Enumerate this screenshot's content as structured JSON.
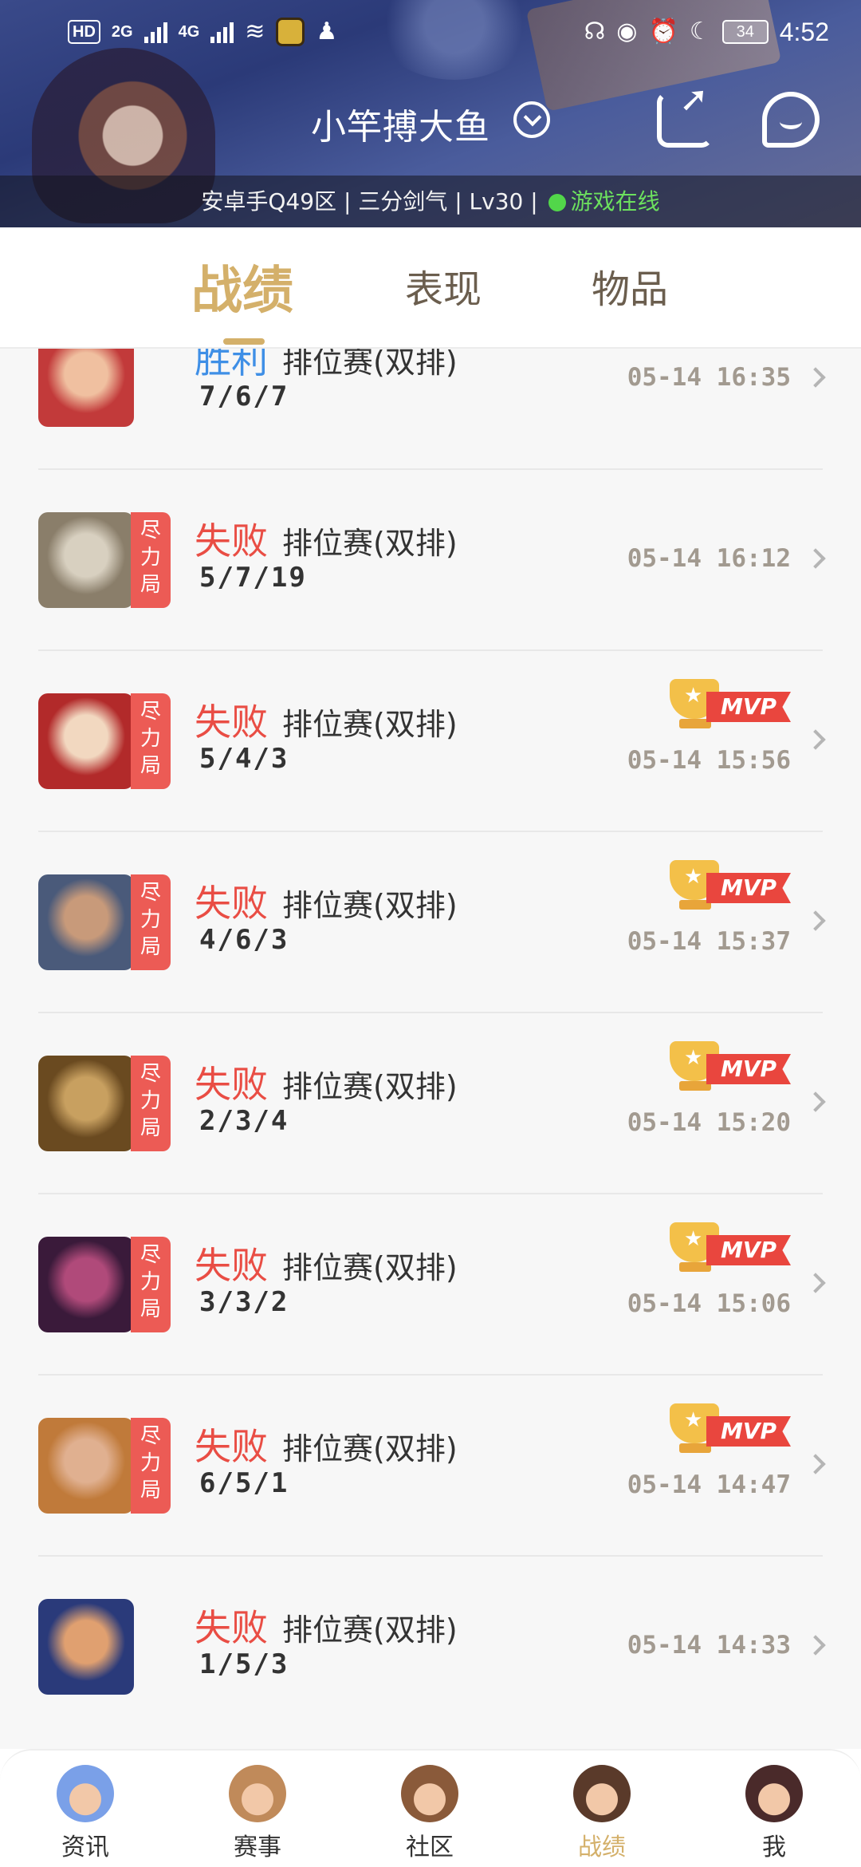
{
  "status_bar": {
    "left_tags": [
      "HD",
      "2G",
      "4G"
    ],
    "battery": "34",
    "time": "4:52"
  },
  "header": {
    "player_name": "小竿搏大鱼",
    "server_info": "安卓手Q49区 | 三分剑气 | Lv30 |",
    "online_status": "游戏在线"
  },
  "tabs": [
    {
      "label": "战绩",
      "active": true
    },
    {
      "label": "表现",
      "active": false
    },
    {
      "label": "物品",
      "active": false
    }
  ],
  "matches": [
    {
      "result": "胜利",
      "outcome": "win",
      "mode": "排位赛(双排)",
      "kda": "7/6/7",
      "time": "05-14 16:35",
      "badge": "",
      "mvp": false,
      "avatar_colors": [
        "#c23a3a",
        "#f0c0a0"
      ]
    },
    {
      "result": "失败",
      "outcome": "loss",
      "mode": "排位赛(双排)",
      "kda": "5/7/19",
      "time": "05-14 16:12",
      "badge": "尽力局",
      "mvp": false,
      "avatar_colors": [
        "#8a7e6a",
        "#d8d0c0"
      ]
    },
    {
      "result": "失败",
      "outcome": "loss",
      "mode": "排位赛(双排)",
      "kda": "5/4/3",
      "time": "05-14 15:56",
      "badge": "尽力局",
      "mvp": true,
      "avatar_colors": [
        "#b22a2a",
        "#f2d8c0"
      ]
    },
    {
      "result": "失败",
      "outcome": "loss",
      "mode": "排位赛(双排)",
      "kda": "4/6/3",
      "time": "05-14 15:37",
      "badge": "尽力局",
      "mvp": true,
      "avatar_colors": [
        "#4a5a7a",
        "#c89a7a"
      ]
    },
    {
      "result": "失败",
      "outcome": "loss",
      "mode": "排位赛(双排)",
      "kda": "2/3/4",
      "time": "05-14 15:20",
      "badge": "尽力局",
      "mvp": true,
      "avatar_colors": [
        "#6a4a20",
        "#c8a060"
      ]
    },
    {
      "result": "失败",
      "outcome": "loss",
      "mode": "排位赛(双排)",
      "kda": "3/3/2",
      "time": "05-14 15:06",
      "badge": "尽力局",
      "mvp": true,
      "avatar_colors": [
        "#3a1a3a",
        "#b04a7a"
      ]
    },
    {
      "result": "失败",
      "outcome": "loss",
      "mode": "排位赛(双排)",
      "kda": "6/5/1",
      "time": "05-14 14:47",
      "badge": "尽力局",
      "mvp": true,
      "avatar_colors": [
        "#c07a3a",
        "#e0b090"
      ]
    },
    {
      "result": "失败",
      "outcome": "loss",
      "mode": "排位赛(双排)",
      "kda": "1/5/3",
      "time": "05-14 14:33",
      "badge": "",
      "mvp": false,
      "avatar_colors": [
        "#2a3a7a",
        "#e0a070"
      ]
    }
  ],
  "mvp_label": "MVP",
  "bottom_nav": [
    {
      "label": "资讯",
      "icon": "news-character-icon",
      "active": false,
      "color": "#7aa0e8"
    },
    {
      "label": "赛事",
      "icon": "events-character-icon",
      "active": false,
      "color": "#c08a5a"
    },
    {
      "label": "社区",
      "icon": "community-character-icon",
      "active": false,
      "color": "#8a5a3a"
    },
    {
      "label": "战绩",
      "icon": "record-character-icon",
      "active": true,
      "color": "#5a3a2a"
    },
    {
      "label": "我",
      "icon": "me-character-icon",
      "active": false,
      "color": "#4a2a2a"
    }
  ],
  "colors": {
    "accent": "#d4b06a",
    "win": "#3f8fe6",
    "loss": "#e94d44",
    "badge": "#ec5b55",
    "online": "#52d64a"
  }
}
